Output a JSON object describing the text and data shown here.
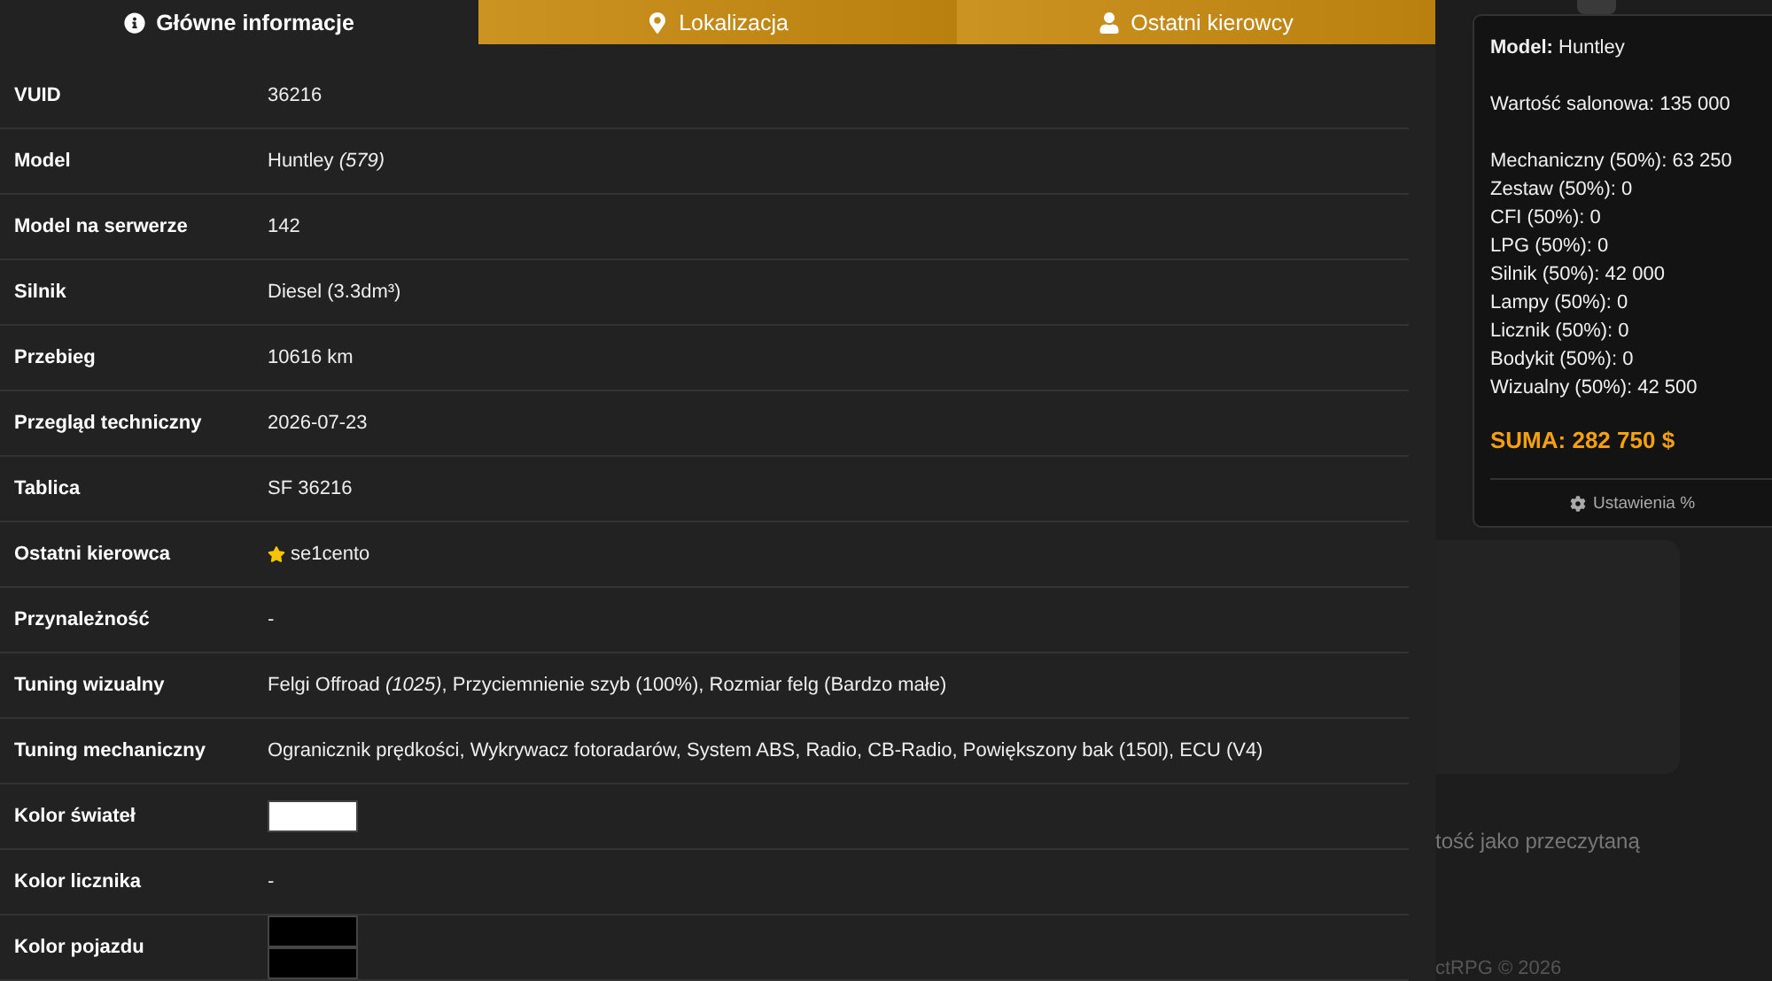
{
  "tabs": [
    {
      "label": "Główne informacje",
      "kind": "info",
      "selected": true
    },
    {
      "label": "Lokalizacja",
      "kind": "pin",
      "selected": false
    },
    {
      "label": "Ostatni kierowcy",
      "kind": "user",
      "selected": false
    }
  ],
  "details": [
    {
      "kind": "text",
      "label": "VUID",
      "value": "36216"
    },
    {
      "kind": "text",
      "label": "Model",
      "value": "Huntley *(579)*"
    },
    {
      "kind": "text",
      "label": "Model na serwerze",
      "value": "142"
    },
    {
      "kind": "text",
      "label": "Silnik",
      "value": "Diesel (3.3dm³)"
    },
    {
      "kind": "text",
      "label": "Przebieg",
      "value": "10616 km"
    },
    {
      "kind": "text",
      "label": "Przegląd techniczny",
      "value": "2026-07-23"
    },
    {
      "kind": "text",
      "label": "Tablica",
      "value": "SF 36216"
    },
    {
      "kind": "driver",
      "label": "Ostatni kierowca",
      "value": "se1cento"
    },
    {
      "kind": "text",
      "label": "Przynależność",
      "value": "-"
    },
    {
      "kind": "text",
      "label": "Tuning wizualny",
      "value": "Felgi Offroad *(1025)*, Przyciemnienie szyb (100%), Rozmiar felg (Bardzo małe)"
    },
    {
      "kind": "text",
      "label": "Tuning mechaniczny",
      "value": "Ogranicznik prędkości, Wykrywacz fotoradarów, System ABS, Radio, CB-Radio, Powiększony bak (150l), ECU (V4)"
    },
    {
      "kind": "swatch",
      "label": "Kolor świateł",
      "swatches": [
        {
          "color": "#ffffff"
        }
      ]
    },
    {
      "kind": "text",
      "label": "Kolor licznika",
      "value": "-"
    },
    {
      "kind": "swatch",
      "label": "Kolor pojazdu",
      "swatches": [
        {
          "color": "#000000"
        },
        {
          "color": "#000000"
        }
      ]
    }
  ],
  "background": {
    "notice": "tość jako przeczytaną",
    "footer": "ctRPG © 2026"
  },
  "price_popup": {
    "model_label": "Model:",
    "model": "Huntley",
    "base": "Wartość salonowa: 135 000",
    "items": [
      "Mechaniczny (50%): 63 250",
      "Zestaw (50%): 0",
      "CFI (50%): 0",
      "LPG (50%): 0",
      "Silnik (50%): 42 000",
      "Lampy (50%): 0",
      "Licznik (50%): 0",
      "Bodykit (50%): 0",
      "Wizualny (50%): 42 500"
    ],
    "total": "SUMA: 282 750 $",
    "settings": "Ustawienia %"
  }
}
